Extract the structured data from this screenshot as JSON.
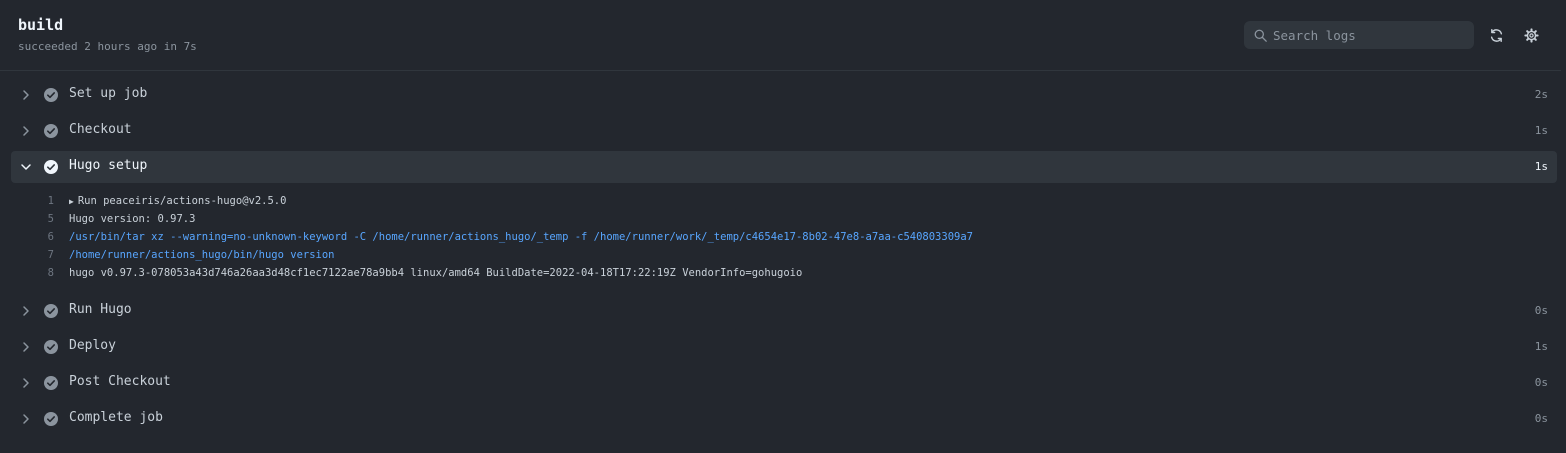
{
  "header": {
    "title": "build",
    "subtitle": "succeeded 2 hours ago in 7s",
    "search_placeholder": "Search logs"
  },
  "icons": {
    "search": "search-icon",
    "refresh": "sync-icon",
    "settings": "gear-icon",
    "chevron_right": "chevron-right-icon",
    "chevron_down": "chevron-down-icon",
    "check": "check-circle-icon"
  },
  "colors": {
    "background": "#23272e",
    "success_icon": "#8b949e",
    "command_text": "#58a6ff"
  },
  "steps": [
    {
      "name": "Set up job",
      "duration": "2s",
      "expanded": false
    },
    {
      "name": "Checkout",
      "duration": "1s",
      "expanded": false
    },
    {
      "name": "Hugo setup",
      "duration": "1s",
      "expanded": true
    },
    {
      "name": "Run Hugo",
      "duration": "0s",
      "expanded": false
    },
    {
      "name": "Deploy",
      "duration": "1s",
      "expanded": false
    },
    {
      "name": "Post Checkout",
      "duration": "0s",
      "expanded": false
    },
    {
      "name": "Complete job",
      "duration": "0s",
      "expanded": false
    }
  ],
  "log_lines": [
    {
      "num": "1",
      "text": "Run peaceiris/actions-hugo@v2.5.0",
      "group": true
    },
    {
      "num": "5",
      "text": "Hugo version: 0.97.3"
    },
    {
      "num": "6",
      "text": "/usr/bin/tar xz --warning=no-unknown-keyword -C /home/runner/actions_hugo/_temp -f /home/runner/work/_temp/c4654e17-8b02-47e8-a7aa-c540803309a7",
      "command": true
    },
    {
      "num": "7",
      "text": "/home/runner/actions_hugo/bin/hugo version",
      "command": true
    },
    {
      "num": "8",
      "text": "hugo v0.97.3-078053a43d746a26aa3d48cf1ec7122ae78a9bb4 linux/amd64 BuildDate=2022-04-18T17:22:19Z VendorInfo=gohugoio"
    }
  ]
}
